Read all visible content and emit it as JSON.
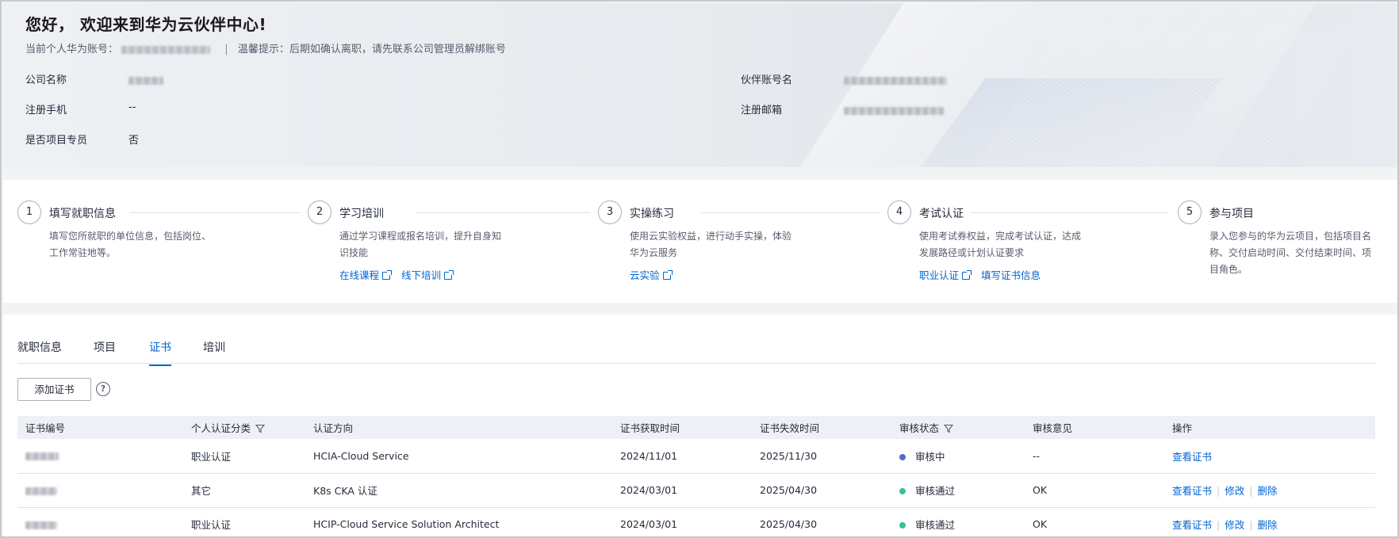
{
  "header": {
    "welcome": "您好， 欢迎来到华为云伙伴中心!",
    "account_label": "当前个人华为账号：",
    "tip": "温馨提示：后期如确认离职，请先联系公司管理员解绑账号",
    "fields": {
      "company_label": "公司名称",
      "phone_label": "注册手机",
      "phone_value": "--",
      "specialist_label": "是否项目专员",
      "specialist_value": "否",
      "partner_account_label": "伙伴账号名",
      "email_label": "注册邮箱"
    }
  },
  "steps": [
    {
      "num": "1",
      "title": "填写就职信息",
      "desc": "填写您所就职的单位信息，包括岗位、工作常驻地等。",
      "links": []
    },
    {
      "num": "2",
      "title": "学习培训",
      "desc": "通过学习课程或报名培训，提升自身知识技能",
      "links": [
        "在线课程",
        "线下培训"
      ]
    },
    {
      "num": "3",
      "title": "实操练习",
      "desc": "使用云实验权益，进行动手实操，体验华为云服务",
      "links": [
        "云实验"
      ]
    },
    {
      "num": "4",
      "title": "考试认证",
      "desc": "使用考试券权益，完成考试认证，达成发展路径或计划认证要求",
      "links": [
        "职业认证",
        "填写证书信息"
      ]
    },
    {
      "num": "5",
      "title": "参与项目",
      "desc": "录入您参与的华为云项目，包括项目名称、交付启动时间、交付结束时间、项目角色。",
      "links": []
    }
  ],
  "tabs": [
    "就职信息",
    "项目",
    "证书",
    "培训"
  ],
  "active_tab": "证书",
  "toolbar": {
    "add_label": "添加证书",
    "help_glyph": "?"
  },
  "table": {
    "headers": [
      "证书编号",
      "个人认证分类",
      "认证方向",
      "证书获取时间",
      "证书失效时间",
      "审核状态",
      "审核意见",
      "操作"
    ],
    "rows": [
      {
        "category": "职业认证",
        "direction": "HCIA-Cloud Service",
        "obtained": "2024/11/01",
        "expires": "2025/11/30",
        "status": "审核中",
        "status_color": "#526ecc",
        "opinion": "--",
        "actions": [
          "查看证书"
        ]
      },
      {
        "category": "其它",
        "direction": "K8s CKA 认证",
        "obtained": "2024/03/01",
        "expires": "2025/04/30",
        "status": "审核通过",
        "status_color": "#3ac295",
        "opinion": "OK",
        "actions": [
          "查看证书",
          "修改",
          "删除"
        ]
      },
      {
        "category": "职业认证",
        "direction": "HCIP-Cloud Service Solution Architect",
        "obtained": "2024/03/01",
        "expires": "2025/04/30",
        "status": "审核通过",
        "status_color": "#3ac295",
        "opinion": "OK",
        "actions": [
          "查看证书",
          "修改",
          "删除"
        ]
      }
    ]
  },
  "colors": {
    "accent": "#0064d2",
    "reviewing": "#526ecc",
    "approved": "#3ac295"
  }
}
